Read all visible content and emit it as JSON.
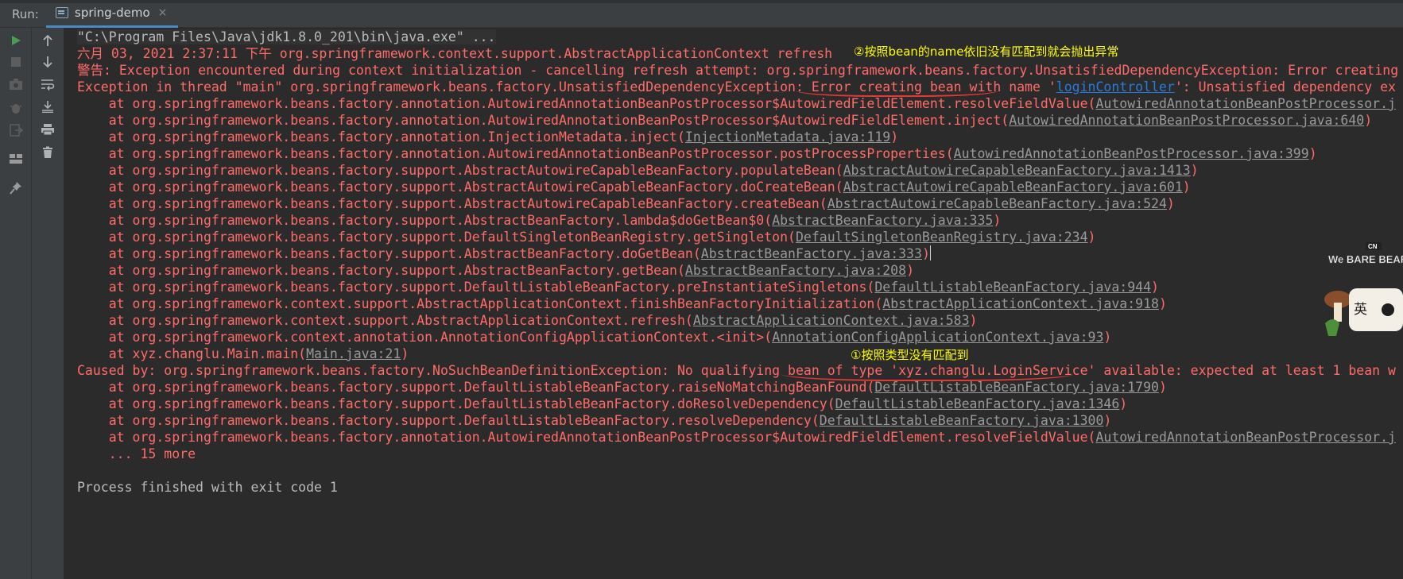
{
  "header": {
    "run_label": "Run:",
    "tab_name": "spring-demo",
    "tab_close": "×"
  },
  "toolbar_left": [
    "run-icon",
    "stop-icon",
    "camera-icon",
    "debug-icon",
    "exit-icon",
    "layout-icon",
    "pin-icon"
  ],
  "toolbar_right": [
    "up-icon",
    "down-icon",
    "soft-wrap-icon",
    "scroll-end-icon",
    "print-icon",
    "trash-icon"
  ],
  "console": {
    "command": "\"C:\\Program Files\\Java\\jdk1.8.0_201\\bin\\java.exe\" ...",
    "log_line": "六月 03, 2021 2:37:11 下午 org.springframework.context.support.AbstractApplicationContext refresh",
    "warn_line": "警告: Exception encountered during context initialization - cancelling refresh attempt: org.springframework.beans.factory.UnsatisfiedDependencyException: Error creating",
    "exception_prefix": "Exception in thread \"main\" org.springframework.beans.factory.UnsatisfiedDependencyException: Error creating bean with name '",
    "exception_link": "loginController",
    "exception_suffix": "': Unsatisfied dependency ex",
    "stack1": [
      {
        "text": "    at org.springframework.beans.factory.annotation.AutowiredAnnotationBeanPostProcessor$AutowiredFieldElement.resolveFieldValue(",
        "link": "AutowiredAnnotationBeanPostProcessor.j",
        "end": ""
      },
      {
        "text": "    at org.springframework.beans.factory.annotation.AutowiredAnnotationBeanPostProcessor$AutowiredFieldElement.inject(",
        "link": "AutowiredAnnotationBeanPostProcessor.java:640",
        "end": ")"
      },
      {
        "text": "    at org.springframework.beans.factory.annotation.InjectionMetadata.inject(",
        "link": "InjectionMetadata.java:119",
        "end": ")"
      },
      {
        "text": "    at org.springframework.beans.factory.annotation.AutowiredAnnotationBeanPostProcessor.postProcessProperties(",
        "link": "AutowiredAnnotationBeanPostProcessor.java:399",
        "end": ")"
      },
      {
        "text": "    at org.springframework.beans.factory.support.AbstractAutowireCapableBeanFactory.populateBean(",
        "link": "AbstractAutowireCapableBeanFactory.java:1413",
        "end": ")"
      },
      {
        "text": "    at org.springframework.beans.factory.support.AbstractAutowireCapableBeanFactory.doCreateBean(",
        "link": "AbstractAutowireCapableBeanFactory.java:601",
        "end": ")"
      },
      {
        "text": "    at org.springframework.beans.factory.support.AbstractAutowireCapableBeanFactory.createBean(",
        "link": "AbstractAutowireCapableBeanFactory.java:524",
        "end": ")"
      },
      {
        "text": "    at org.springframework.beans.factory.support.AbstractBeanFactory.lambda$doGetBean$0(",
        "link": "AbstractBeanFactory.java:335",
        "end": ")"
      },
      {
        "text": "    at org.springframework.beans.factory.support.DefaultSingletonBeanRegistry.getSingleton(",
        "link": "DefaultSingletonBeanRegistry.java:234",
        "end": ")"
      },
      {
        "text": "    at org.springframework.beans.factory.support.AbstractBeanFactory.doGetBean(",
        "link": "AbstractBeanFactory.java:333",
        "end": ")"
      },
      {
        "text": "    at org.springframework.beans.factory.support.AbstractBeanFactory.getBean(",
        "link": "AbstractBeanFactory.java:208",
        "end": ")"
      },
      {
        "text": "    at org.springframework.beans.factory.support.DefaultListableBeanFactory.preInstantiateSingletons(",
        "link": "DefaultListableBeanFactory.java:944",
        "end": ")"
      },
      {
        "text": "    at org.springframework.context.support.AbstractApplicationContext.finishBeanFactoryInitialization(",
        "link": "AbstractApplicationContext.java:918",
        "end": ")"
      },
      {
        "text": "    at org.springframework.context.support.AbstractApplicationContext.refresh(",
        "link": "AbstractApplicationContext.java:583",
        "end": ")"
      },
      {
        "text": "    at org.springframework.context.annotation.AnnotationConfigApplicationContext.<init>(",
        "link": "AnnotationConfigApplicationContext.java:93",
        "end": ")"
      },
      {
        "text": "    at xyz.changlu.Main.main(",
        "link": "Main.java:21",
        "end": ")"
      }
    ],
    "caused_by": "Caused by: org.springframework.beans.factory.NoSuchBeanDefinitionException: No qualifying bean of type 'xyz.changlu.LoginService' available: expected at least 1 bean w",
    "stack2": [
      {
        "text": "    at org.springframework.beans.factory.support.DefaultListableBeanFactory.raiseNoMatchingBeanFound(",
        "link": "DefaultListableBeanFactory.java:1790",
        "end": ")"
      },
      {
        "text": "    at org.springframework.beans.factory.support.DefaultListableBeanFactory.doResolveDependency(",
        "link": "DefaultListableBeanFactory.java:1346",
        "end": ")"
      },
      {
        "text": "    at org.springframework.beans.factory.support.DefaultListableBeanFactory.resolveDependency(",
        "link": "DefaultListableBeanFactory.java:1300",
        "end": ")"
      },
      {
        "text": "    at org.springframework.beans.factory.annotation.AutowiredAnnotationBeanPostProcessor$AutowiredFieldElement.resolveFieldValue(",
        "link": "AutowiredAnnotationBeanPostProcessor.j",
        "end": ""
      }
    ],
    "more": "    ... 15 more",
    "exit": "Process finished with exit code 1"
  },
  "annotations": {
    "note2": "②按照bean的name依旧没有匹配到就会抛出异常",
    "note1": "①按照类型没有匹配到"
  },
  "sticker": {
    "brand": "We BARE BEARS",
    "label": "英",
    "network": "CN"
  },
  "colors": {
    "background": "#2b2b2b",
    "error": "#ff6b68",
    "link_blue": "#287bde",
    "annotation": "#ffff00",
    "underline": "#e53935"
  }
}
